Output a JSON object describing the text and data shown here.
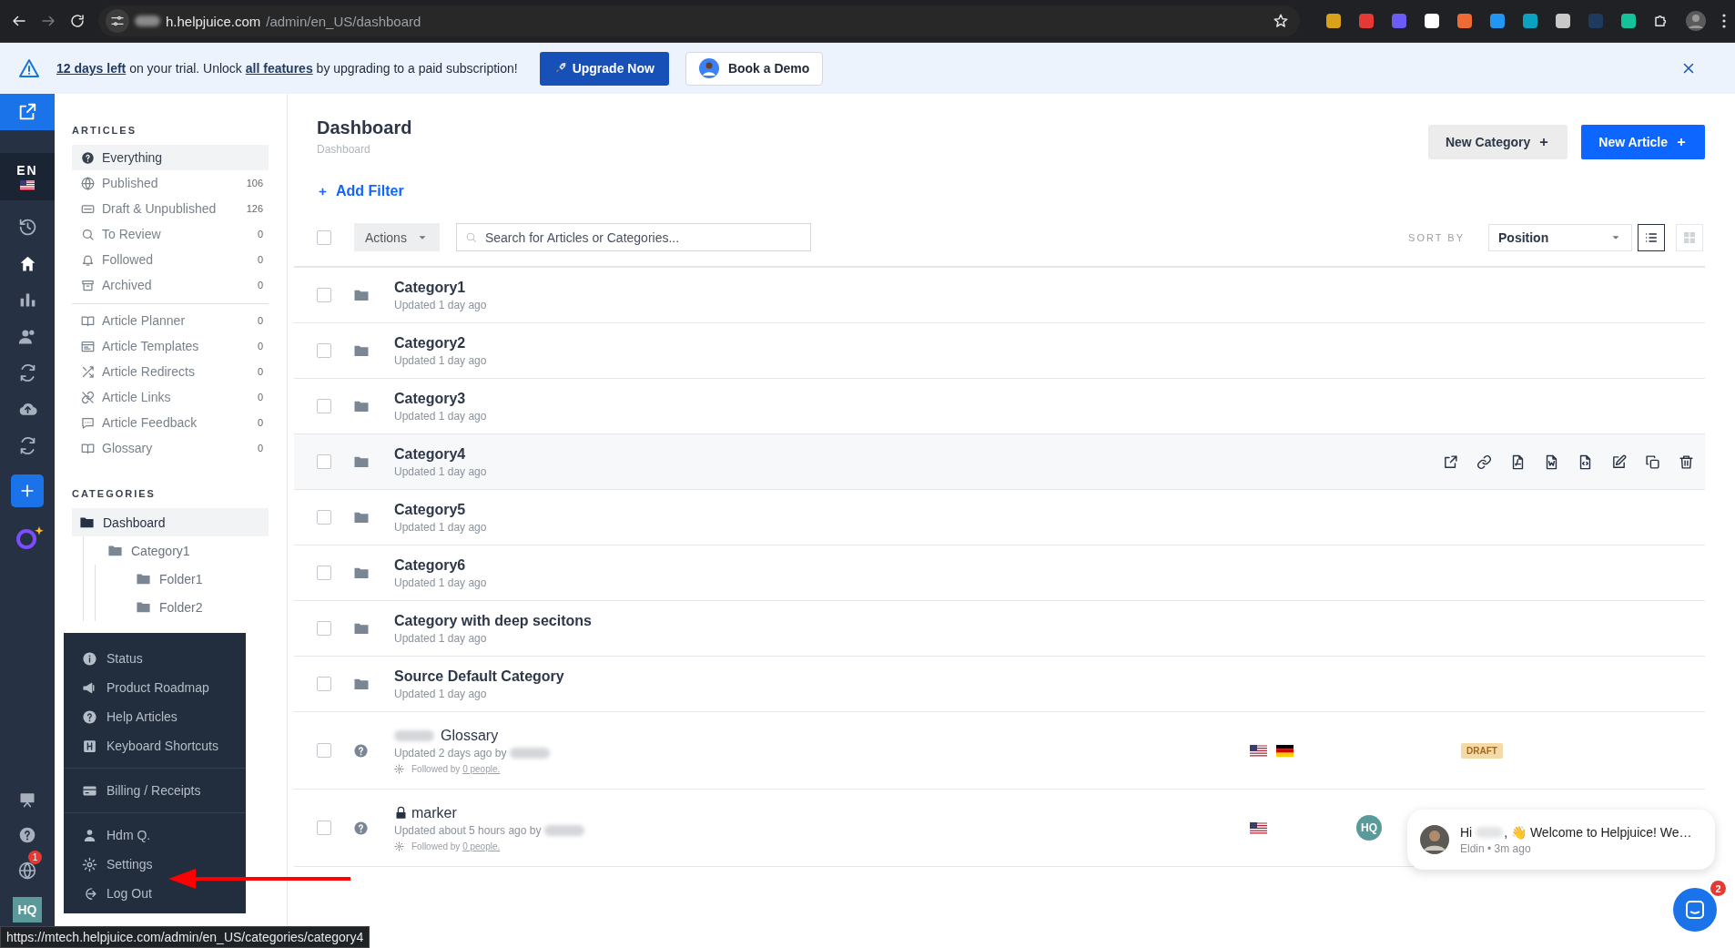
{
  "browser": {
    "url_host": "h.helpjuice.com",
    "url_path": "/admin/en_US/dashboard"
  },
  "banner": {
    "days_link": "12 days left",
    "text_1": "on your trial. Unlock",
    "features_link": "all features",
    "text_2": "by upgrading to a paid subscription!",
    "upgrade_button": "Upgrade Now",
    "demo_button": "Book a Demo"
  },
  "rail": {
    "language": "EN",
    "notification_count": "1",
    "avatar": "HQ"
  },
  "sidebar": {
    "articles_heading": "ARTICLES",
    "article_filters": [
      {
        "label": "Everything",
        "selected": true
      },
      {
        "label": "Published",
        "count": "106",
        "selected": false
      },
      {
        "label": "Draft & Unpublished",
        "count": "126",
        "selected": false
      },
      {
        "label": "To Review",
        "count": "0",
        "selected": false
      },
      {
        "label": "Followed",
        "count": "0",
        "selected": false
      },
      {
        "label": "Archived",
        "count": "0",
        "selected": false
      }
    ],
    "article_tools": [
      {
        "label": "Article Planner",
        "count": "0"
      },
      {
        "label": "Article Templates",
        "count": "0"
      },
      {
        "label": "Article Redirects",
        "count": "0"
      },
      {
        "label": "Article Links",
        "count": "0"
      },
      {
        "label": "Article Feedback",
        "count": "0"
      },
      {
        "label": "Glossary",
        "count": "0"
      }
    ],
    "categories_heading": "CATEGORIES",
    "categories": [
      {
        "label": "Dashboard",
        "selected": true,
        "children": [
          {
            "label": "Category1",
            "selected": false,
            "children": [
              {
                "label": "Folder1",
                "selected": false
              },
              {
                "label": "Folder2",
                "selected": false
              }
            ]
          }
        ]
      }
    ]
  },
  "main": {
    "title": "Dashboard",
    "breadcrumb": "Dashboard",
    "new_category": "New Category",
    "new_article": "New Article",
    "add_filter": "Add Filter",
    "actions": "Actions",
    "search_placeholder": "Search for Articles or Categories...",
    "sort_label": "SORT BY",
    "sort_value": "Position",
    "select_all_checked": false,
    "views": [
      {
        "kind": "list",
        "selected": true
      },
      {
        "kind": "grid",
        "selected": false
      }
    ],
    "rows": [
      {
        "kind": "category",
        "title": "Category1",
        "updated": "Updated 1 day ago",
        "checked": false,
        "hovered": false
      },
      {
        "kind": "category",
        "title": "Category2",
        "updated": "Updated 1 day ago",
        "checked": false,
        "hovered": false
      },
      {
        "kind": "category",
        "title": "Category3",
        "updated": "Updated 1 day ago",
        "checked": false,
        "hovered": false
      },
      {
        "kind": "category",
        "title": "Category4",
        "updated": "Updated 1 day ago",
        "checked": false,
        "hovered": true
      },
      {
        "kind": "category",
        "title": "Category5",
        "updated": "Updated 1 day ago",
        "checked": false,
        "hovered": false
      },
      {
        "kind": "category",
        "title": "Category6",
        "updated": "Updated 1 day ago",
        "checked": false,
        "hovered": false
      },
      {
        "kind": "category",
        "title": "Category with deep secitons",
        "updated": "Updated 1 day ago",
        "checked": false,
        "hovered": false
      },
      {
        "kind": "category",
        "title": "Source Default Category",
        "updated": "Updated 1 day ago",
        "checked": false,
        "hovered": false
      },
      {
        "kind": "article",
        "title": "Glossary",
        "title_redacted": true,
        "locked": false,
        "updated": "Updated 2 days ago by",
        "followed": "Followed by",
        "followers_link": "0 people.",
        "flags": [
          {
            "kind": "us"
          },
          {
            "kind": "de"
          }
        ],
        "badge": "DRAFT",
        "checked": false,
        "hovered": false
      },
      {
        "kind": "article",
        "title": "marker",
        "title_redacted": false,
        "locked": true,
        "updated": "Updated about 5 hours ago by",
        "followed": "Followed by",
        "followers_link": "0 people.",
        "flags": [
          {
            "kind": "us"
          }
        ],
        "avatar": "HQ",
        "checked": false,
        "hovered": false
      }
    ]
  },
  "menu": {
    "sections": [
      [
        {
          "label": "Status"
        },
        {
          "label": "Product Roadmap"
        },
        {
          "label": "Help Articles"
        },
        {
          "label": "Keyboard Shortcuts"
        }
      ],
      [
        {
          "label": "Billing / Receipts"
        }
      ],
      [
        {
          "label": "Hdm Q."
        },
        {
          "label": "Settings"
        },
        {
          "label": "Log Out"
        }
      ]
    ]
  },
  "status_url": "https://mtech.helpjuice.com/admin/en_US/categories/category4",
  "chat": {
    "greeting": "Hi",
    "message": ", 👋 Welcome to Helpjuice! We…",
    "meta": "Eldin • 3m ago",
    "unread": "2"
  }
}
